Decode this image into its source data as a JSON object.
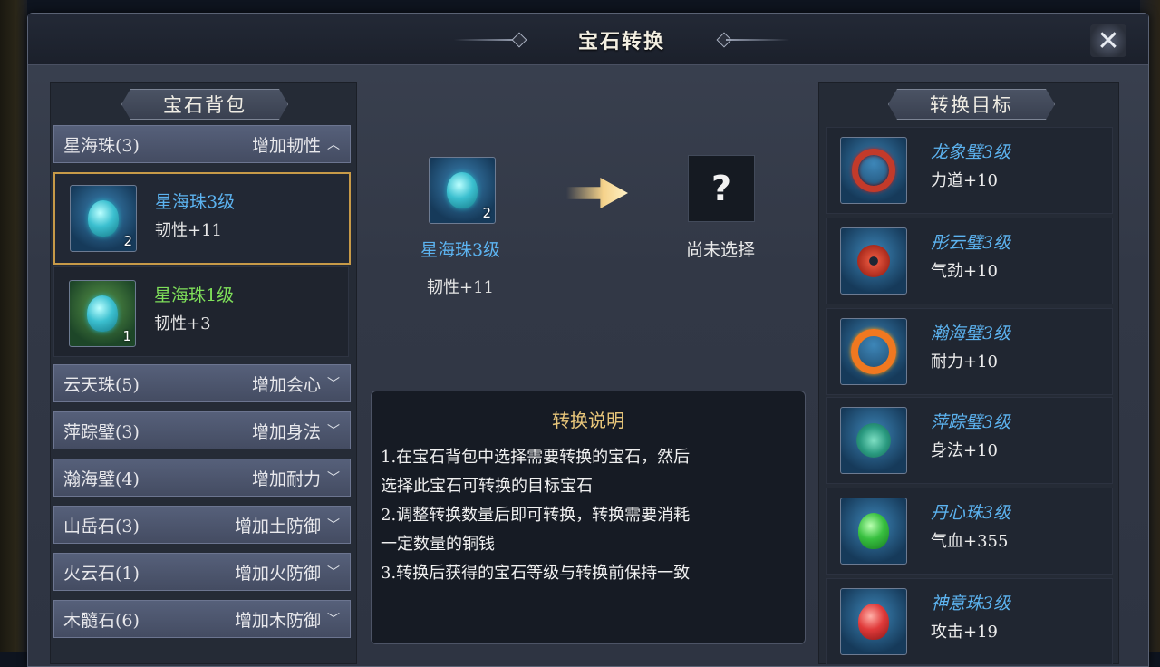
{
  "window": {
    "title": "宝石转换"
  },
  "left_panel": {
    "title": "宝石背包",
    "categories": [
      {
        "name": "星海珠(3)",
        "effect": "增加韧性",
        "chevron": "chevron-up-icon"
      },
      {
        "name": "云天珠(5)",
        "effect": "增加会心",
        "chevron": "chevron-down-icon"
      },
      {
        "name": "萍踪璧(3)",
        "effect": "增加身法",
        "chevron": "chevron-down-icon"
      },
      {
        "name": "瀚海璧(4)",
        "effect": "增加耐力",
        "chevron": "chevron-down-icon"
      },
      {
        "name": "山岳石(3)",
        "effect": "增加土防御",
        "chevron": "chevron-down-icon"
      },
      {
        "name": "火云石(1)",
        "effect": "增加火防御",
        "chevron": "chevron-down-icon"
      },
      {
        "name": "木髓石(6)",
        "effect": "增加木防御",
        "chevron": "chevron-down-icon"
      }
    ],
    "items": [
      {
        "name": "星海珠3级",
        "stat": "韧性+11",
        "qty": "2",
        "selected": true
      },
      {
        "name": "星海珠1级",
        "stat": "韧性+3",
        "qty": "1",
        "selected": false
      }
    ]
  },
  "conversion": {
    "source": {
      "name": "星海珠3级",
      "stat": "韧性+11",
      "qty": "2"
    },
    "target": {
      "symbol": "?",
      "label": "尚未选择"
    }
  },
  "description": {
    "title": "转换说明",
    "lines": [
      "1.在宝石背包中选择需要转换的宝石，然后",
      "选择此宝石可转换的目标宝石",
      "2.调整转换数量后即可转换，转换需要消耗",
      "一定数量的铜钱",
      "3.转换后获得的宝石等级与转换前保持一致"
    ]
  },
  "right_panel": {
    "title": "转换目标",
    "targets": [
      {
        "name": "龙象璧3级",
        "stat": "力道+10",
        "icon": "red-ring-gem-icon"
      },
      {
        "name": "彤云璧3级",
        "stat": "气劲+10",
        "icon": "red-disc-gem-icon"
      },
      {
        "name": "瀚海璧3级",
        "stat": "耐力+10",
        "icon": "orange-ring-gem-icon"
      },
      {
        "name": "萍踪璧3级",
        "stat": "身法+10",
        "icon": "jade-disc-gem-icon"
      },
      {
        "name": "丹心珠3级",
        "stat": "气血+355",
        "icon": "green-bead-gem-icon"
      },
      {
        "name": "神意珠3级",
        "stat": "攻击+19",
        "icon": "red-bead-gem-icon"
      }
    ]
  },
  "colors": {
    "item_name_blue": "#5cb3f0",
    "item_name_green": "#7fe05a",
    "selected_border": "#c79a48",
    "desc_title": "#e8c67a"
  }
}
